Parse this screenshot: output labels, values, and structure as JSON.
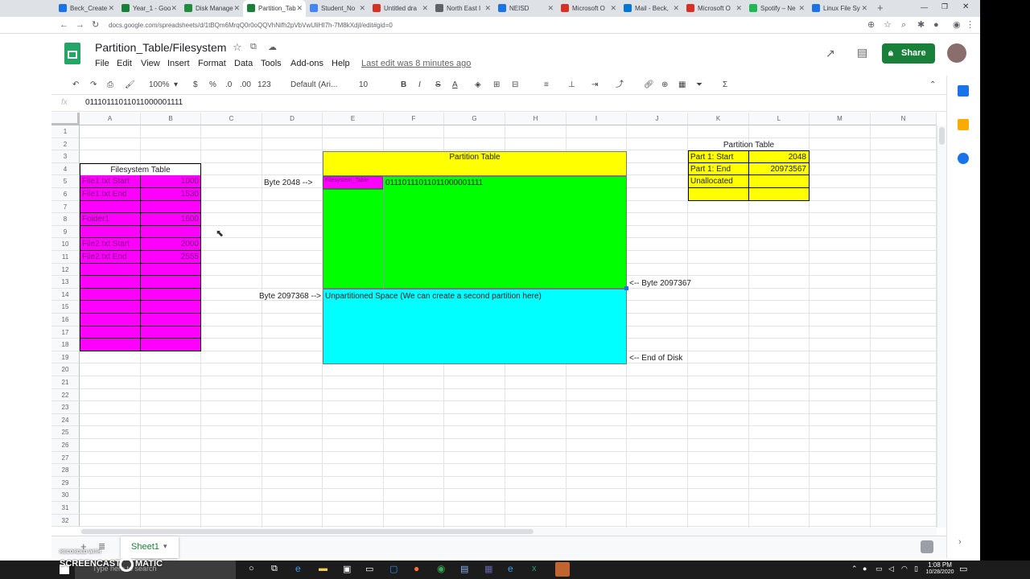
{
  "browser": {
    "tabs": [
      {
        "label": "Beck_Create",
        "color": "#1a73e8",
        "active": false
      },
      {
        "label": "Year_1 - Goo",
        "color": "#188038",
        "active": false
      },
      {
        "label": "Disk Manage",
        "color": "#1e8e3e",
        "active": false
      },
      {
        "label": "Partition_Tab",
        "color": "#188038",
        "active": true
      },
      {
        "label": "Student_No",
        "color": "#4285f4",
        "active": false
      },
      {
        "label": "Untitled dra",
        "color": "#d93025",
        "active": false
      },
      {
        "label": "North East I",
        "color": "#5f6368",
        "active": false
      },
      {
        "label": "NEISD",
        "color": "#1a73e8",
        "active": false
      },
      {
        "label": "Microsoft O",
        "color": "#d93025",
        "active": false
      },
      {
        "label": "Mail - Beck,",
        "color": "#0078d4",
        "active": false
      },
      {
        "label": "Microsoft O",
        "color": "#d93025",
        "active": false
      },
      {
        "label": "Spotify – Ne",
        "color": "#1db954",
        "active": false
      },
      {
        "label": "Linux File Sy",
        "color": "#1a73e8",
        "active": false
      }
    ],
    "new_tab": "+",
    "url": "docs.google.com/spreadsheets/d/1tBQm6MrqQ0r0oQQVhNifh2pVbVwUliHI7h-7M8kXdjI/edit#gid=0"
  },
  "sheets": {
    "title": "Partition_Table/Filesystem",
    "menu": [
      "File",
      "Edit",
      "View",
      "Insert",
      "Format",
      "Data",
      "Tools",
      "Add-ons",
      "Help"
    ],
    "last_edit": "Last edit was 8 minutes ago",
    "share_label": "Share",
    "toolbar": {
      "zoom": "100%",
      "currency": "$",
      "percent": "%",
      "dec_less": ".0",
      "dec_more": ".00",
      "format_more": "123",
      "font": "Default (Ari...",
      "font_size": "10",
      "bold": "B",
      "italic": "I",
      "strike": "S",
      "text_color": "A",
      "sum": "Σ"
    },
    "formula_label": "fx",
    "formula_value": "01110111011011000001111",
    "columns": [
      "A",
      "B",
      "C",
      "D",
      "E",
      "F",
      "G",
      "H",
      "I",
      "J",
      "K",
      "L",
      "M",
      "N"
    ],
    "rows": [
      "1",
      "2",
      "3",
      "4",
      "5",
      "6",
      "7",
      "8",
      "9",
      "10",
      "11",
      "12",
      "13",
      "14",
      "15",
      "16",
      "17",
      "18",
      "19",
      "20",
      "21",
      "22",
      "23",
      "24",
      "25",
      "26",
      "27",
      "28",
      "29",
      "30",
      "31",
      "32"
    ],
    "filesystem_table": {
      "title": "Filesystem Table",
      "entries": [
        {
          "name": "File1.txt Start",
          "value": "1000"
        },
        {
          "name": "File1.txt End",
          "value": "1530"
        },
        {
          "name": "",
          "value": ""
        },
        {
          "name": "Folder1",
          "value": "1600"
        },
        {
          "name": "",
          "value": ""
        },
        {
          "name": "File2.txt Start",
          "value": "2000"
        },
        {
          "name": "File2.txt End",
          "value": "2555"
        }
      ]
    },
    "partition_diagram": {
      "title": "Partition Table",
      "fs_table_label": "Filesystem_Table",
      "binary": "01110111011011000001111",
      "byte_start": "Byte 2048 -->",
      "byte_end": "<-- Byte 2097367",
      "byte_unpart": "Byte 2097368 -->",
      "unpartitioned": "Unpartitioned Space (We can create a second partition here)",
      "end_of_disk": "<-- End of Disk"
    },
    "partition_table": {
      "title": "Partition Table",
      "rows": [
        {
          "label": "Part 1: Start",
          "value": "2048"
        },
        {
          "label": "Part 1: End",
          "value": "20973567"
        },
        {
          "label": "Unallocated",
          "value": ""
        },
        {
          "label": "",
          "value": ""
        }
      ]
    },
    "sheet_tab": "Sheet1"
  },
  "taskbar": {
    "search_placeholder": "Type here to search",
    "time": "1:08 PM",
    "date": "10/28/2020"
  },
  "watermark": {
    "line1": "RECORDED WITH",
    "line2": "SCREENCAST",
    "line3": "MATIC"
  }
}
